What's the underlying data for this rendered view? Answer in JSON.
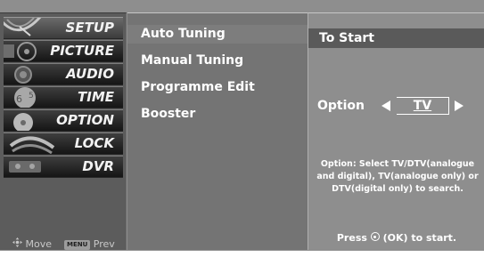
{
  "sidebar": {
    "tabs": [
      {
        "label": "SETUP"
      },
      {
        "label": "PICTURE"
      },
      {
        "label": "AUDIO"
      },
      {
        "label": "TIME"
      },
      {
        "label": "OPTION"
      },
      {
        "label": "LOCK"
      },
      {
        "label": "DVR"
      }
    ],
    "active_tab": "SETUP",
    "footer": {
      "move_label": "Move",
      "menu_key": "MENU",
      "prev_label": "Prev"
    }
  },
  "menu": {
    "items": [
      {
        "label": "Auto Tuning"
      },
      {
        "label": "Manual Tuning"
      },
      {
        "label": "Programme Edit"
      },
      {
        "label": "Booster"
      }
    ],
    "selected": "Auto Tuning"
  },
  "sub_panel": {
    "title": "To Start",
    "option_label": "Option",
    "option_value": "TV",
    "description": "Option: Select TV/DTV(analogue and digital), TV(analogue only) or DTV(digital only) to search.",
    "press_prefix": "Press",
    "press_suffix": "(OK) to start."
  },
  "colors": {
    "background": "#8e8e8e",
    "tab_column": "#5c5c5c",
    "menu_panel": "#747474",
    "title_bar": "#5a5a5a",
    "text": "#ffffff"
  },
  "icons": [
    "satellite-dish",
    "film-reel",
    "speaker",
    "clock",
    "option-disc",
    "padlock",
    "recorder",
    "move-arrows-icon",
    "ok-button-icon"
  ]
}
